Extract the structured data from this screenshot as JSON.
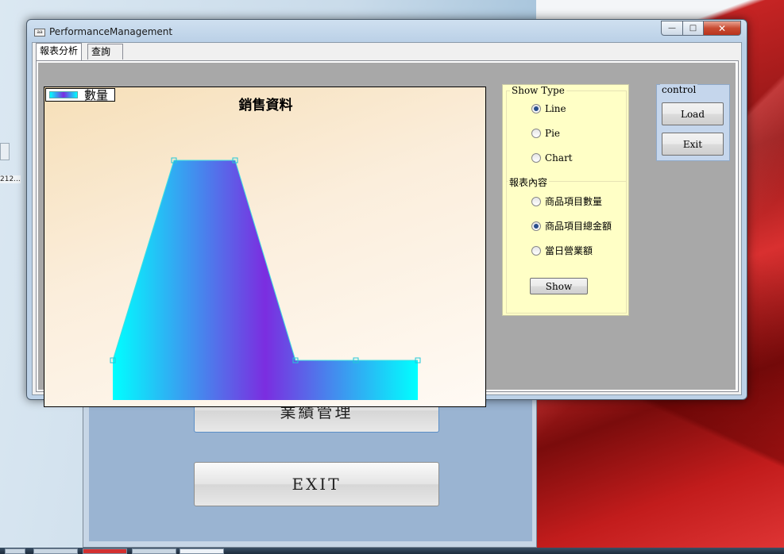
{
  "desktop": {
    "icon_text": "212..."
  },
  "background_window": {
    "button_performance": "業績管理",
    "button_exit": "EXIT"
  },
  "window": {
    "title": "PerformanceManagement",
    "icon_text": "aa",
    "minimize_symbol": "—",
    "maximize_symbol": "□",
    "close_symbol": "✕"
  },
  "tabs": [
    {
      "label": "報表分析",
      "active": true
    },
    {
      "label": "查詢",
      "active": false
    }
  ],
  "chart_data": {
    "type": "area",
    "title": "銷售資料",
    "xlabel": "",
    "ylabel": "",
    "legend": "top-left",
    "grid": false,
    "series": [
      {
        "name": "數量",
        "values": [
          1,
          6,
          6,
          1,
          1,
          1
        ]
      }
    ],
    "x": [
      0,
      1,
      2,
      3,
      4,
      5
    ],
    "ylim": [
      0,
      7
    ],
    "colors": [
      "#00ffff",
      "#7b2de0",
      "#00ffff"
    ]
  },
  "show_type": {
    "legend": "Show Type",
    "options": [
      {
        "label": "Line",
        "checked": true
      },
      {
        "label": "Pie",
        "checked": false
      },
      {
        "label": "Chart",
        "checked": false
      }
    ]
  },
  "report_content": {
    "legend": "報表內容",
    "options": [
      {
        "label": "商品項目數量",
        "checked": false
      },
      {
        "label": "商品項目總金額",
        "checked": true
      },
      {
        "label": "當日營業額",
        "checked": false
      }
    ],
    "show_button": "Show"
  },
  "control": {
    "legend": "control",
    "load_button": "Load",
    "exit_button": "Exit"
  },
  "colors": {
    "group_bg": "#ffffc6",
    "control_bg": "#c5d6ec",
    "accent": "#2a4e8c"
  }
}
